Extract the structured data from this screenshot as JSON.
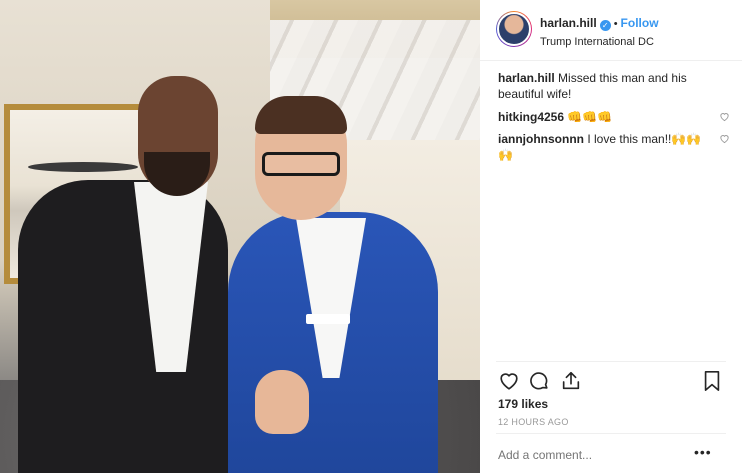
{
  "post": {
    "username": "harlan.hill",
    "follow_label": "Follow",
    "location": "Trump International DC",
    "caption_text": "Missed this man and his beautiful wife!",
    "comments": [
      {
        "username": "hitking4256",
        "text": "👊👊👊"
      },
      {
        "username": "iannjohnsonnn",
        "text": "I love this man!!🙌🙌🙌"
      }
    ],
    "likes": "179 likes",
    "timestamp": "12 HOURS AGO",
    "add_comment_placeholder": "Add a comment...",
    "more_label": "•••"
  },
  "colors": {
    "link_blue": "#3897f0",
    "text_dark": "#262626",
    "muted": "#999999"
  },
  "icons": [
    "verified-badge-icon",
    "heart-icon",
    "comment-icon",
    "share-icon",
    "bookmark-icon",
    "comment-like-icon"
  ]
}
